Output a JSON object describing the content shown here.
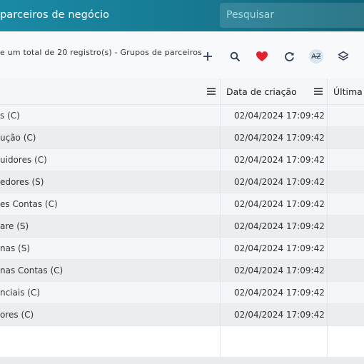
{
  "header": {
    "title": "parceiros de negócio",
    "search_placeholder": "Pesquisar"
  },
  "toolbar": {
    "info": "e um total de 20 registro(s) - Grupos de parceiros",
    "icons": [
      "plus-icon",
      "search-icon",
      "heart-icon",
      "refresh-icon",
      "sort-az-icon",
      "layers-icon"
    ],
    "heart_color": "#e0242f",
    "az_label": "AZ"
  },
  "table": {
    "columns": [
      {
        "label": ""
      },
      {
        "label": "Data de criação"
      },
      {
        "label": "Última a"
      }
    ],
    "rows": [
      {
        "name": "s (C)",
        "date": "02/04/2024 17:09:42"
      },
      {
        "name": "ução (C)",
        "date": "02/04/2024 17:09:42"
      },
      {
        "name": "uidores (C)",
        "date": "02/04/2024 17:09:42"
      },
      {
        "name": "edores (S)",
        "date": "02/04/2024 17:09:42"
      },
      {
        "name": "es Contas (C)",
        "date": "02/04/2024 17:09:42"
      },
      {
        "name": "are (S)",
        "date": "02/04/2024 17:09:42"
      },
      {
        "name": "nas (S)",
        "date": "02/04/2024 17:09:42"
      },
      {
        "name": "nas Contas (C)",
        "date": "02/04/2024 17:09:42"
      },
      {
        "name": "nciais (C)",
        "date": "02/04/2024 17:09:42"
      },
      {
        "name": "ores (C)",
        "date": "02/04/2024 17:09:42"
      }
    ]
  }
}
